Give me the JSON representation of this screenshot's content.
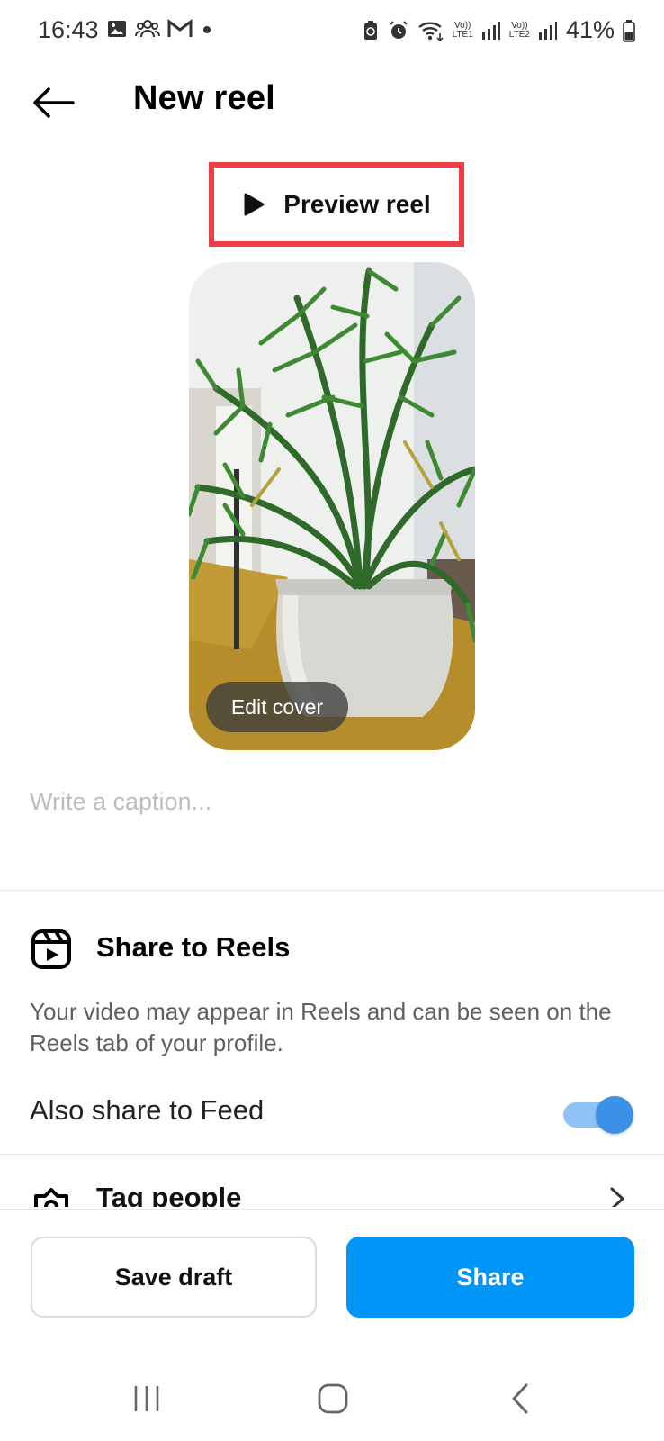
{
  "status_bar": {
    "time": "16:43",
    "lte1": "LTE1",
    "lte2": "LTE2",
    "vo": "Vo))",
    "battery": "41%",
    "icons": [
      "gallery-icon",
      "group-icon",
      "gmail-icon",
      "dot-icon",
      "battery-saver-icon",
      "alarm-icon",
      "wifi-icon",
      "signal-icon",
      "battery-icon"
    ]
  },
  "header": {
    "title": "New reel"
  },
  "preview": {
    "label": "Preview reel"
  },
  "cover": {
    "edit_label": "Edit cover"
  },
  "caption": {
    "placeholder": "Write a caption..."
  },
  "share_to_reels": {
    "title": "Share to Reels",
    "description": "Your video may appear in Reels and can be seen on the Reels tab of your profile.",
    "feed_label": "Also share to Feed",
    "feed_enabled": true
  },
  "tag_people": {
    "label": "Tag people"
  },
  "actions": {
    "save_draft": "Save draft",
    "share": "Share"
  },
  "colors": {
    "accent": "#0095f6",
    "highlight": "#ef3e47",
    "toggle": "#3b90e8"
  }
}
